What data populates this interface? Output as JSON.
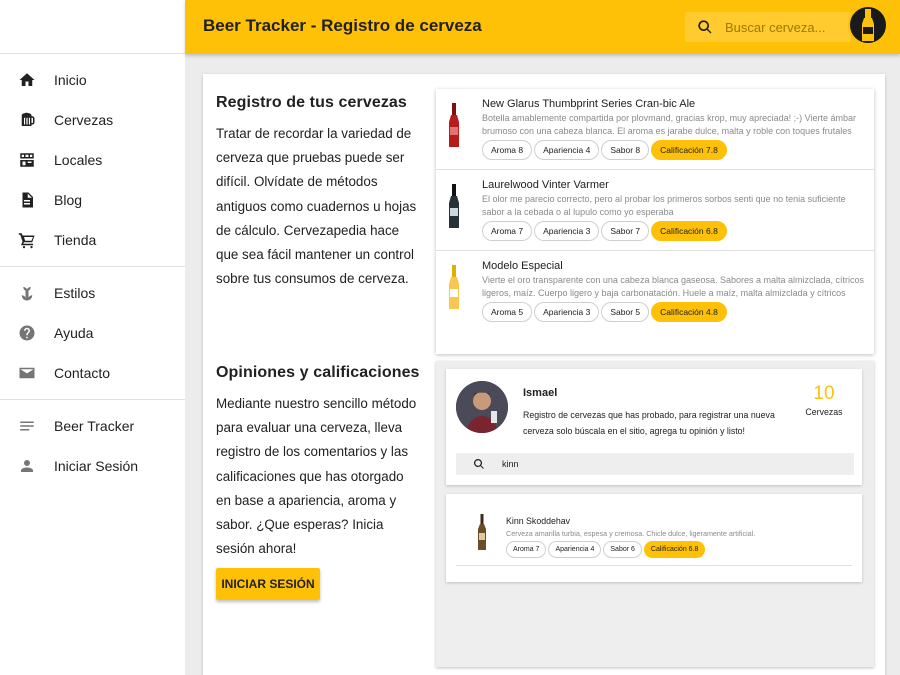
{
  "header": {
    "title": "Beer Tracker - Registro de cerveza",
    "search_placeholder": "Buscar cerveza...",
    "accent_color": "#ffc107"
  },
  "sidebar": {
    "groups": [
      [
        {
          "label": "Inicio",
          "icon": "home-icon"
        },
        {
          "label": "Cervezas",
          "icon": "beer-mug-icon"
        },
        {
          "label": "Locales",
          "icon": "store-icon"
        },
        {
          "label": "Blog",
          "icon": "document-icon"
        },
        {
          "label": "Tienda",
          "icon": "cart-icon"
        }
      ],
      [
        {
          "label": "Estilos",
          "icon": "hops-icon"
        },
        {
          "label": "Ayuda",
          "icon": "help-icon"
        },
        {
          "label": "Contacto",
          "icon": "mail-icon"
        }
      ],
      [
        {
          "label": "Beer Tracker",
          "icon": "menu-lines-icon"
        },
        {
          "label": "Iniciar Sesión",
          "icon": "person-icon"
        }
      ]
    ]
  },
  "main": {
    "section1": {
      "title": "Registro de tus cervezas",
      "text": "Tratar de recordar la variedad de cerveza que pruebas puede ser difícil. Olvídate de métodos antiguos como cuadernos u hojas de cálculo. Cervezapedia hace que sea fácil mantener un control sobre tus consumos de cerveza."
    },
    "section2": {
      "title": "Opiniones y calificaciones",
      "text": "Mediante nuestro sencillo método para evaluar una cerveza, lleva registro de los comentarios y las calificaciones que has otorgado en base a apariencia, aroma y sabor. ¿Que esperas? Inicia sesión ahora!",
      "button": "INICIAR SESIÓN"
    }
  },
  "beers": [
    {
      "name": "New Glarus Thumbprint Series Cran-bic Ale",
      "desc": "Botella amablemente compartida por plovmand, gracias krop, muy apreciada! ;-) Vierte ámbar brumoso con una cabeza blanca. El aroma es jarabe dulce, malta y roble con toques frutales secos",
      "chips": [
        "Aroma 8",
        "Apariencia 4",
        "Sabor 8",
        "Calificación 7.8"
      ],
      "bottle_color": "#b71c1c"
    },
    {
      "name": "Laurelwood Vinter Varmer",
      "desc": "El olor me parecio correcto, pero al probar los primeros sorbos senti que no tenia suficiente sabor a la cebada o al lupulo como yo esperaba",
      "chips": [
        "Aroma 7",
        "Apariencia 3",
        "Sabor 7",
        "Calificación 6.8"
      ],
      "bottle_color": "#263238"
    },
    {
      "name": "Modelo Especial",
      "desc": "Vierte el oro transparente con una cabeza blanca gaseosa. Sabores a malta almizclada, cítricos ligeros, maíz. Cuerpo ligero y baja carbonatación. Huele a maíz, malta almizclada y cítricos ligeros.",
      "chips": [
        "Aroma 5",
        "Apariencia 3",
        "Sabor 5",
        "Calificación 4.8"
      ],
      "bottle_color": "#f9c74f"
    }
  ],
  "profile": {
    "name": "Ismael",
    "text": "Registro de cervezas que has probado, para registrar una nueva cerveza solo búscala en el sitio, agrega tu opinión y listo!",
    "count": "10",
    "count_label": "Cervezas",
    "search_value": "kinn"
  },
  "result": {
    "name": "Kinn Skoddehav",
    "desc": "Cerveza amarilla turbia, espesa y cremosa. Chicle dulce, ligeramente artificial.",
    "chips": [
      "Aroma 7",
      "Apariencia 4",
      "Sabor 6",
      "Calificación 6.8"
    ],
    "bottle_color": "#6d4c2a"
  }
}
